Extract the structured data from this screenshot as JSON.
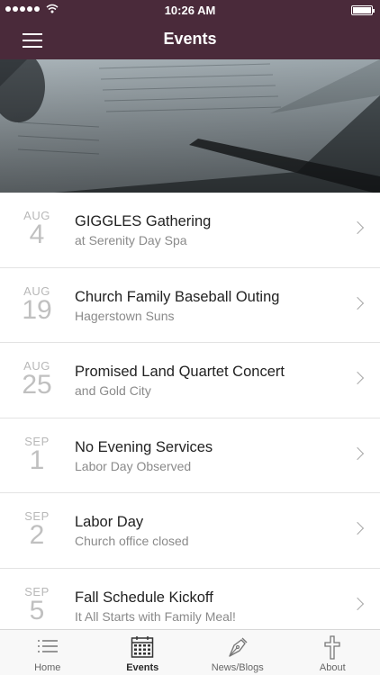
{
  "status_bar": {
    "time": "10:26 AM"
  },
  "nav": {
    "title": "Events"
  },
  "events": [
    {
      "month": "AUG",
      "day": "4",
      "title": "GIGGLES Gathering",
      "subtitle": "at Serenity Day Spa"
    },
    {
      "month": "AUG",
      "day": "19",
      "title": "Church Family Baseball Outing",
      "subtitle": "Hagerstown Suns"
    },
    {
      "month": "AUG",
      "day": "25",
      "title": "Promised Land Quartet Concert",
      "subtitle": "and Gold City"
    },
    {
      "month": "SEP",
      "day": "1",
      "title": "No Evening Services",
      "subtitle": "Labor Day Observed"
    },
    {
      "month": "SEP",
      "day": "2",
      "title": "Labor Day",
      "subtitle": "Church office closed"
    },
    {
      "month": "SEP",
      "day": "5",
      "title": "Fall Schedule Kickoff",
      "subtitle": "It All Starts with Family Meal!"
    }
  ],
  "tabs": [
    {
      "label": "Home",
      "icon": "list-icon"
    },
    {
      "label": "Events",
      "icon": "calendar-icon",
      "active": true
    },
    {
      "label": "News/Blogs",
      "icon": "pen-nib-icon"
    },
    {
      "label": "About",
      "icon": "cross-icon"
    }
  ],
  "colors": {
    "nav_background": "#4a2a3a",
    "tab_bar_background": "#f8f8f8"
  }
}
